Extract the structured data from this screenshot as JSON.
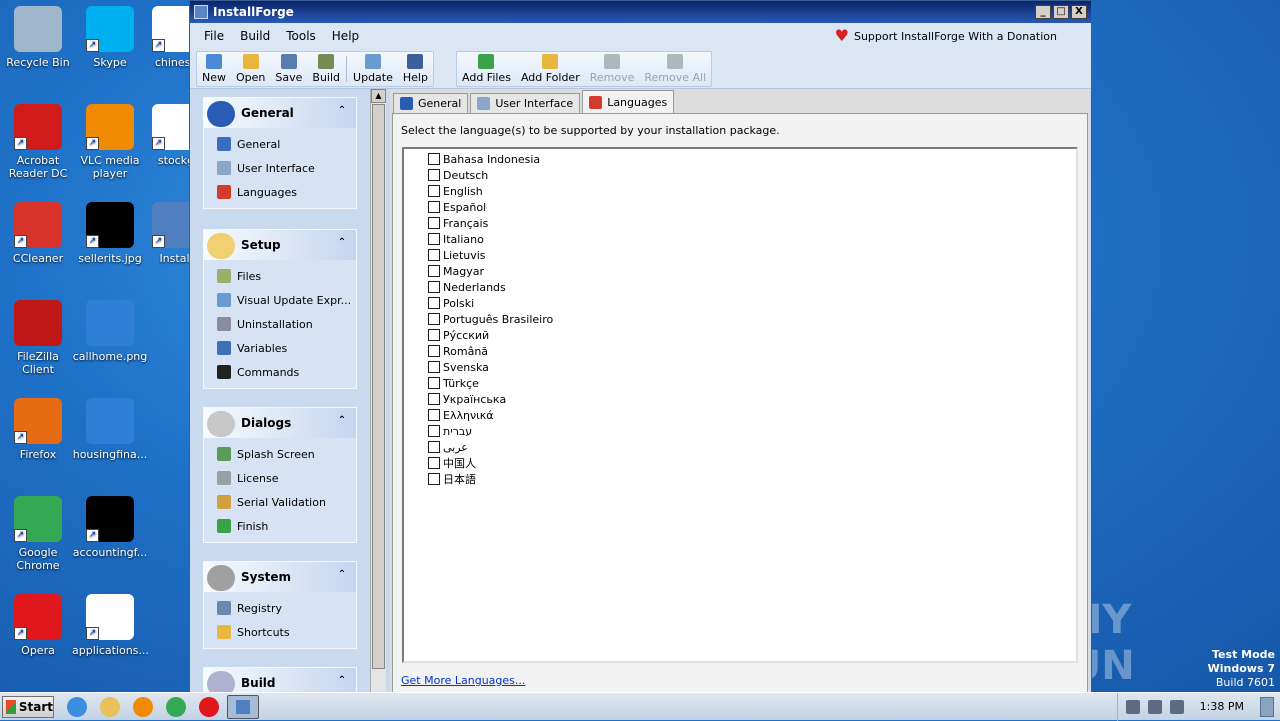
{
  "desktop": {
    "icons": [
      {
        "label": "Recycle Bin",
        "icon": "recycle-bin-icon",
        "color": "#9fb6cc"
      },
      {
        "label": "Skype",
        "icon": "skype-icon",
        "color": "#00aff0"
      },
      {
        "label": "chinese",
        "icon": "word-doc-icon",
        "color": "#ffffff"
      },
      {
        "label": "Acrobat Reader DC",
        "icon": "acrobat-icon",
        "color": "#d11a1a"
      },
      {
        "label": "VLC media player",
        "icon": "vlc-icon",
        "color": "#f08a00"
      },
      {
        "label": "stockg",
        "icon": "word-doc-icon",
        "color": "#ffffff"
      },
      {
        "label": "CCleaner",
        "icon": "ccleaner-icon",
        "color": "#d8332a"
      },
      {
        "label": "sellerits.jpg",
        "icon": "image-file-icon",
        "color": "#000000"
      },
      {
        "label": "Install",
        "icon": "installforge-icon",
        "color": "#4f7fbf"
      },
      {
        "label": "FileZilla Client",
        "icon": "filezilla-icon",
        "color": "#c01818"
      },
      {
        "label": "callhome.png",
        "icon": "image-file-icon",
        "color": "#2f7fd8"
      },
      {
        "label": "Firefox",
        "icon": "firefox-icon",
        "color": "#e66b12"
      },
      {
        "label": "housingfina...",
        "icon": "image-file-icon",
        "color": "#2f7fd8"
      },
      {
        "label": "Google Chrome",
        "icon": "chrome-icon",
        "color": "#34a853"
      },
      {
        "label": "accountingf...",
        "icon": "image-file-icon",
        "color": "#000000"
      },
      {
        "label": "Opera",
        "icon": "opera-icon",
        "color": "#e0171c"
      },
      {
        "label": "applications...",
        "icon": "word-doc-icon",
        "color": "#ffffff"
      }
    ],
    "watermark": "ANY RUN",
    "version": {
      "line1": "Test Mode",
      "line2": "Windows 7",
      "line3": "Build 7601"
    }
  },
  "window": {
    "title": "InstallForge",
    "controls": {
      "minimize": "_",
      "maximize": "□",
      "close": "X"
    },
    "menu": [
      "File",
      "Build",
      "Tools",
      "Help"
    ],
    "donate": "Support InstallForge With a Donation",
    "toolbar": {
      "group1": [
        {
          "label": "New",
          "icon": "new-file-icon",
          "color": "#4a8ad6"
        },
        {
          "label": "Open",
          "icon": "open-folder-icon",
          "color": "#e8b63c"
        },
        {
          "label": "Save",
          "icon": "save-icon",
          "color": "#5a7db0"
        },
        {
          "label": "Build",
          "icon": "build-gear-icon",
          "color": "#7a8a55"
        },
        {
          "label": "Update",
          "icon": "update-icon",
          "color": "#6a9ad0"
        },
        {
          "label": "Help",
          "icon": "help-book-icon",
          "color": "#3f5f9a"
        }
      ],
      "group2": [
        {
          "label": "Add Files",
          "icon": "add-files-icon",
          "color": "#3aa34a",
          "disabled": false
        },
        {
          "label": "Add Folder",
          "icon": "add-folder-icon",
          "color": "#e8b63c",
          "disabled": false
        },
        {
          "label": "Remove",
          "icon": "remove-icon",
          "color": "#b0b6bd",
          "disabled": true
        },
        {
          "label": "Remove All",
          "icon": "remove-all-icon",
          "color": "#b0b6bd",
          "disabled": true
        }
      ]
    },
    "sidebar": {
      "groups": [
        {
          "title": "General",
          "icon": "info-icon",
          "color": "#2a5bb5",
          "items": [
            {
              "label": "General",
              "icon": "info-icon",
              "color": "#3a6fc2"
            },
            {
              "label": "User Interface",
              "icon": "ui-window-icon",
              "color": "#8aa6c8"
            },
            {
              "label": "Languages",
              "icon": "languages-flags-icon",
              "color": "#d23a2a"
            }
          ]
        },
        {
          "title": "Setup",
          "icon": "folder-icon",
          "color": "#f0d070",
          "items": [
            {
              "label": "Files",
              "icon": "files-icon",
              "color": "#9ab06a"
            },
            {
              "label": "Visual Update Expr...",
              "icon": "update-icon",
              "color": "#6a9ad0"
            },
            {
              "label": "Uninstallation",
              "icon": "uninstall-icon",
              "color": "#8a8aa0"
            },
            {
              "label": "Variables",
              "icon": "variables-icon",
              "color": "#3f6fb5"
            },
            {
              "label": "Commands",
              "icon": "console-icon",
              "color": "#222222"
            }
          ]
        },
        {
          "title": "Dialogs",
          "icon": "dialog-window-icon",
          "color": "#c8c8c8",
          "items": [
            {
              "label": "Splash Screen",
              "icon": "splash-icon",
              "color": "#5a9a5a"
            },
            {
              "label": "License",
              "icon": "license-icon",
              "color": "#9aa0a6"
            },
            {
              "label": "Serial Validation",
              "icon": "serial-icon",
              "color": "#d0a040"
            },
            {
              "label": "Finish",
              "icon": "finish-flag-icon",
              "color": "#3aa34a"
            }
          ]
        },
        {
          "title": "System",
          "icon": "gears-icon",
          "color": "#a0a0a0",
          "items": [
            {
              "label": "Registry",
              "icon": "registry-icon",
              "color": "#6a8ab0"
            },
            {
              "label": "Shortcuts",
              "icon": "shortcuts-icon",
              "color": "#e8b63c"
            }
          ]
        },
        {
          "title": "Build",
          "icon": "build-disc-icon",
          "color": "#b0b0d0",
          "items": []
        }
      ]
    },
    "tabs": [
      {
        "label": "General",
        "icon": "info-icon",
        "color": "#2a5bb5"
      },
      {
        "label": "User Interface",
        "icon": "ui-window-icon",
        "color": "#8aa6c8"
      },
      {
        "label": "Languages",
        "icon": "languages-flags-icon",
        "color": "#d23a2a"
      }
    ],
    "active_tab": "Languages",
    "instruction": "Select the language(s) to be supported by your installation package.",
    "languages": [
      "Bahasa Indonesia",
      "Deutsch",
      "English",
      "Español",
      "Français",
      "Italiano",
      "Lietuvis",
      "Magyar",
      "Nederlands",
      "Polski",
      "Português Brasileiro",
      "Рýсский",
      "Română",
      "Svenska",
      "Türkçe",
      "Українська",
      "Ελληνικά",
      "עברית",
      "عربى",
      "中国人",
      "日本語"
    ],
    "more_link": "Get More Languages..."
  },
  "taskbar": {
    "start": "Start",
    "quick": [
      {
        "icon": "ie-icon",
        "color": "#3b8de0"
      },
      {
        "icon": "explorer-folder-icon",
        "color": "#e8c15a"
      },
      {
        "icon": "media-player-icon",
        "color": "#f08a00"
      },
      {
        "icon": "chrome-icon",
        "color": "#34a853"
      },
      {
        "icon": "opera-icon",
        "color": "#e0171c"
      },
      {
        "icon": "installforge-icon",
        "color": "#4f7fbf",
        "active": true
      }
    ],
    "clock": "1:38 PM"
  }
}
